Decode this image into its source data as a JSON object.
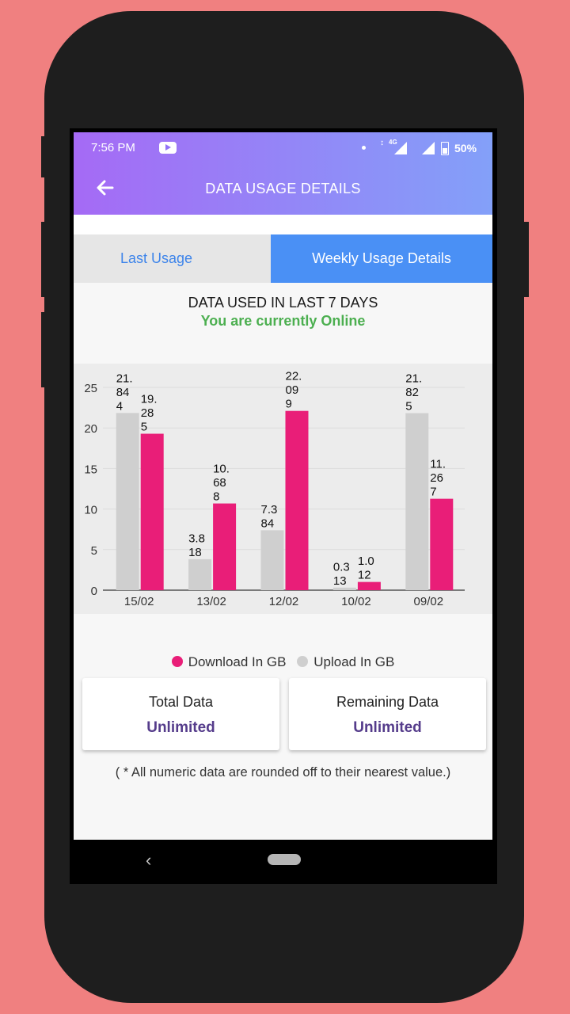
{
  "status_bar": {
    "time": "7:56 PM",
    "network": "4G",
    "battery": "50%"
  },
  "app_bar": {
    "title": "DATA USAGE DETAILS",
    "back_icon": "arrow-left-icon"
  },
  "tabs": [
    {
      "label": "Last Usage",
      "selected": false
    },
    {
      "label": "Weekly Usage Details",
      "selected": true
    }
  ],
  "summary": {
    "heading": "DATA USED IN LAST 7 DAYS",
    "status": "You are currently Online"
  },
  "chart_data": {
    "type": "bar",
    "categories": [
      "15/02",
      "13/02",
      "12/02",
      "10/02",
      "09/02"
    ],
    "series": [
      {
        "name": "Upload In GB",
        "color": "#cfcfcf",
        "values": [
          21.844,
          3.818,
          7.384,
          0.313,
          21.825
        ],
        "labels": [
          "21.\n84\n4",
          "3.8\n18",
          "7.3\n84",
          "0.3\n13",
          "21.\n82\n5"
        ]
      },
      {
        "name": "Download In GB",
        "color": "#e91e78",
        "values": [
          19.285,
          10.688,
          22.099,
          1.012,
          11.267
        ],
        "labels": [
          "19.\n28\n5",
          "10.\n68\n8",
          "22.\n09\n9",
          "1.0\n12",
          "11.\n26\n7"
        ]
      }
    ],
    "yticks": [
      "0",
      "5",
      "10",
      "15",
      "20",
      "25"
    ],
    "ylim": [
      0,
      25
    ],
    "grid": true,
    "legend_position": "bottom"
  },
  "legend": [
    {
      "label": "Download In GB",
      "color": "#e91e78"
    },
    {
      "label": "Upload In GB",
      "color": "#cfcfcf"
    }
  ],
  "cards": [
    {
      "label": "Total Data",
      "value": "Unlimited"
    },
    {
      "label": "Remaining Data",
      "value": "Unlimited"
    }
  ],
  "footnote": "( * All numeric data are rounded off to their nearest value.)"
}
